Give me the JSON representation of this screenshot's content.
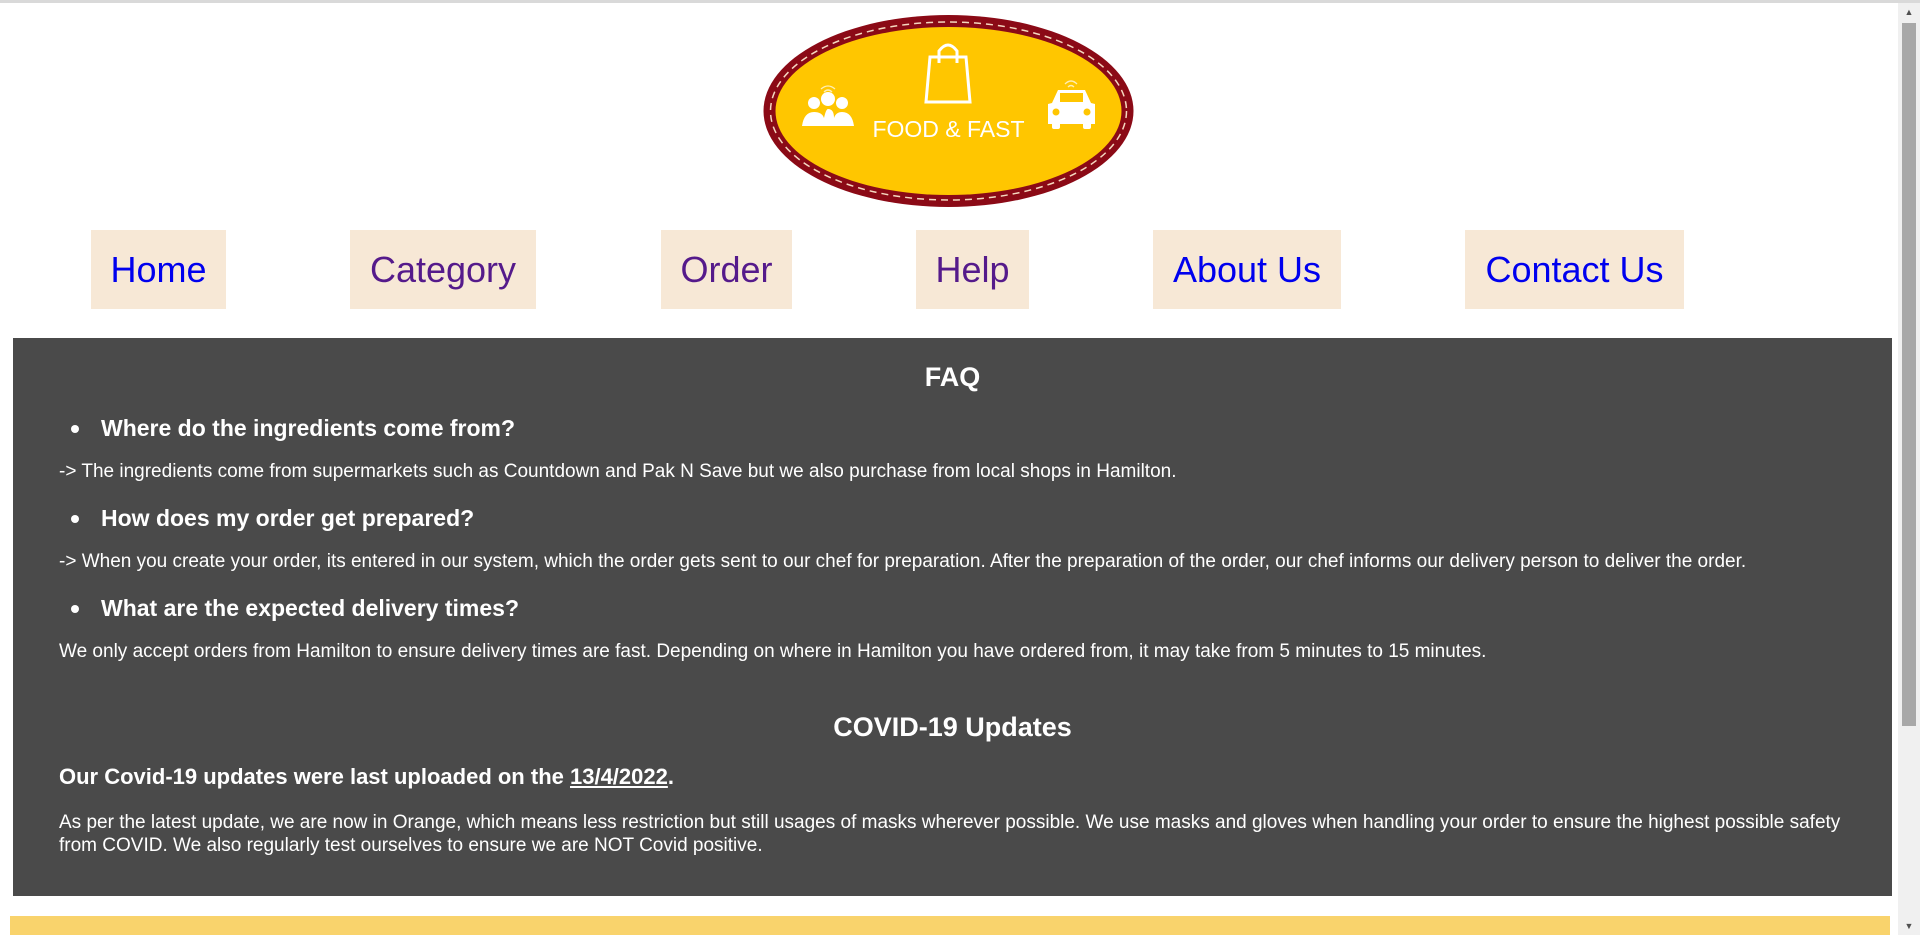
{
  "logo": {
    "text": "FOOD & FAST",
    "colors": {
      "fill": "#ffc600",
      "ring": "#8b0a16"
    }
  },
  "nav": [
    {
      "label": "Home"
    },
    {
      "label": "Category"
    },
    {
      "label": "Order"
    },
    {
      "label": "Help"
    },
    {
      "label": "About Us"
    },
    {
      "label": "Contact Us"
    }
  ],
  "faq": {
    "title": "FAQ",
    "items": [
      {
        "question": "Where do the ingredients come from?",
        "answer": "-> The ingredients come from supermarkets such as Countdown and Pak N Save but we also purchase from local shops in Hamilton."
      },
      {
        "question": "How does my order get prepared?",
        "answer": "-> When you create your order, its entered in our system, which the order gets sent to our chef for preparation. After the preparation of the order, our chef informs our delivery person to deliver the order."
      },
      {
        "question": "What are the expected delivery times?",
        "answer": "We only accept orders from Hamilton to ensure delivery times are fast. Depending on where in Hamilton you have ordered from, it may take from 5 minutes to 15 minutes."
      }
    ]
  },
  "covid": {
    "title": "COVID-19 Updates",
    "subtitle_prefix": "Our Covid-19 updates were last uploaded on the ",
    "date": "13/4/2022",
    "subtitle_suffix": ".",
    "body": "As per the latest update, we are now in Orange, which means less restriction but still usages of masks wherever possible. We use masks and gloves when handling your order to ensure the highest possible safety from COVID. We also regularly test ourselves to ensure we are NOT Covid positive."
  },
  "colors": {
    "content_bg": "#4a4a4a",
    "nav_bg": "#f7e8d6",
    "footer_bg": "#f9d36c"
  }
}
